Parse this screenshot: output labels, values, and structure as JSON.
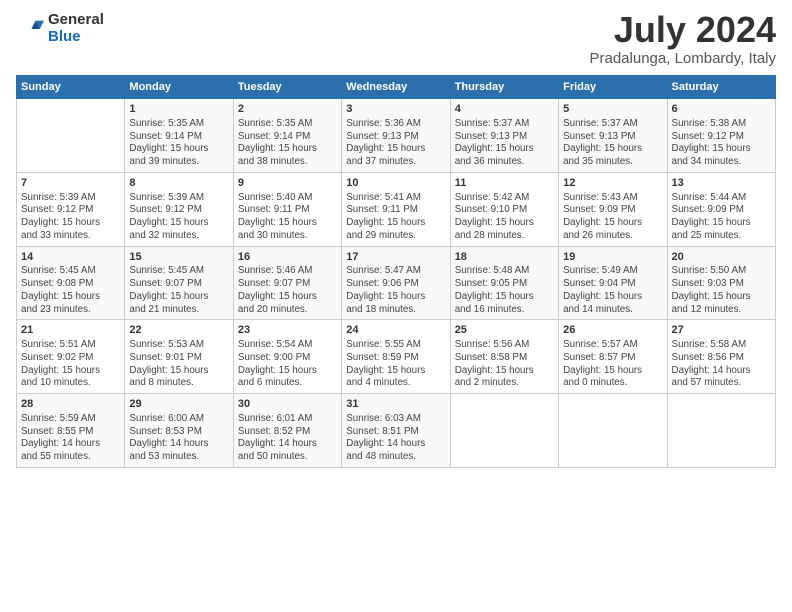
{
  "logo": {
    "general": "General",
    "blue": "Blue"
  },
  "title": "July 2024",
  "subtitle": "Pradalunga, Lombardy, Italy",
  "headers": [
    "Sunday",
    "Monday",
    "Tuesday",
    "Wednesday",
    "Thursday",
    "Friday",
    "Saturday"
  ],
  "weeks": [
    [
      {
        "day": "",
        "info": ""
      },
      {
        "day": "1",
        "info": "Sunrise: 5:35 AM\nSunset: 9:14 PM\nDaylight: 15 hours\nand 39 minutes."
      },
      {
        "day": "2",
        "info": "Sunrise: 5:35 AM\nSunset: 9:14 PM\nDaylight: 15 hours\nand 38 minutes."
      },
      {
        "day": "3",
        "info": "Sunrise: 5:36 AM\nSunset: 9:13 PM\nDaylight: 15 hours\nand 37 minutes."
      },
      {
        "day": "4",
        "info": "Sunrise: 5:37 AM\nSunset: 9:13 PM\nDaylight: 15 hours\nand 36 minutes."
      },
      {
        "day": "5",
        "info": "Sunrise: 5:37 AM\nSunset: 9:13 PM\nDaylight: 15 hours\nand 35 minutes."
      },
      {
        "day": "6",
        "info": "Sunrise: 5:38 AM\nSunset: 9:12 PM\nDaylight: 15 hours\nand 34 minutes."
      }
    ],
    [
      {
        "day": "7",
        "info": "Sunrise: 5:39 AM\nSunset: 9:12 PM\nDaylight: 15 hours\nand 33 minutes."
      },
      {
        "day": "8",
        "info": "Sunrise: 5:39 AM\nSunset: 9:12 PM\nDaylight: 15 hours\nand 32 minutes."
      },
      {
        "day": "9",
        "info": "Sunrise: 5:40 AM\nSunset: 9:11 PM\nDaylight: 15 hours\nand 30 minutes."
      },
      {
        "day": "10",
        "info": "Sunrise: 5:41 AM\nSunset: 9:11 PM\nDaylight: 15 hours\nand 29 minutes."
      },
      {
        "day": "11",
        "info": "Sunrise: 5:42 AM\nSunset: 9:10 PM\nDaylight: 15 hours\nand 28 minutes."
      },
      {
        "day": "12",
        "info": "Sunrise: 5:43 AM\nSunset: 9:09 PM\nDaylight: 15 hours\nand 26 minutes."
      },
      {
        "day": "13",
        "info": "Sunrise: 5:44 AM\nSunset: 9:09 PM\nDaylight: 15 hours\nand 25 minutes."
      }
    ],
    [
      {
        "day": "14",
        "info": "Sunrise: 5:45 AM\nSunset: 9:08 PM\nDaylight: 15 hours\nand 23 minutes."
      },
      {
        "day": "15",
        "info": "Sunrise: 5:45 AM\nSunset: 9:07 PM\nDaylight: 15 hours\nand 21 minutes."
      },
      {
        "day": "16",
        "info": "Sunrise: 5:46 AM\nSunset: 9:07 PM\nDaylight: 15 hours\nand 20 minutes."
      },
      {
        "day": "17",
        "info": "Sunrise: 5:47 AM\nSunset: 9:06 PM\nDaylight: 15 hours\nand 18 minutes."
      },
      {
        "day": "18",
        "info": "Sunrise: 5:48 AM\nSunset: 9:05 PM\nDaylight: 15 hours\nand 16 minutes."
      },
      {
        "day": "19",
        "info": "Sunrise: 5:49 AM\nSunset: 9:04 PM\nDaylight: 15 hours\nand 14 minutes."
      },
      {
        "day": "20",
        "info": "Sunrise: 5:50 AM\nSunset: 9:03 PM\nDaylight: 15 hours\nand 12 minutes."
      }
    ],
    [
      {
        "day": "21",
        "info": "Sunrise: 5:51 AM\nSunset: 9:02 PM\nDaylight: 15 hours\nand 10 minutes."
      },
      {
        "day": "22",
        "info": "Sunrise: 5:53 AM\nSunset: 9:01 PM\nDaylight: 15 hours\nand 8 minutes."
      },
      {
        "day": "23",
        "info": "Sunrise: 5:54 AM\nSunset: 9:00 PM\nDaylight: 15 hours\nand 6 minutes."
      },
      {
        "day": "24",
        "info": "Sunrise: 5:55 AM\nSunset: 8:59 PM\nDaylight: 15 hours\nand 4 minutes."
      },
      {
        "day": "25",
        "info": "Sunrise: 5:56 AM\nSunset: 8:58 PM\nDaylight: 15 hours\nand 2 minutes."
      },
      {
        "day": "26",
        "info": "Sunrise: 5:57 AM\nSunset: 8:57 PM\nDaylight: 15 hours\nand 0 minutes."
      },
      {
        "day": "27",
        "info": "Sunrise: 5:58 AM\nSunset: 8:56 PM\nDaylight: 14 hours\nand 57 minutes."
      }
    ],
    [
      {
        "day": "28",
        "info": "Sunrise: 5:59 AM\nSunset: 8:55 PM\nDaylight: 14 hours\nand 55 minutes."
      },
      {
        "day": "29",
        "info": "Sunrise: 6:00 AM\nSunset: 8:53 PM\nDaylight: 14 hours\nand 53 minutes."
      },
      {
        "day": "30",
        "info": "Sunrise: 6:01 AM\nSunset: 8:52 PM\nDaylight: 14 hours\nand 50 minutes."
      },
      {
        "day": "31",
        "info": "Sunrise: 6:03 AM\nSunset: 8:51 PM\nDaylight: 14 hours\nand 48 minutes."
      },
      {
        "day": "",
        "info": ""
      },
      {
        "day": "",
        "info": ""
      },
      {
        "day": "",
        "info": ""
      }
    ]
  ]
}
